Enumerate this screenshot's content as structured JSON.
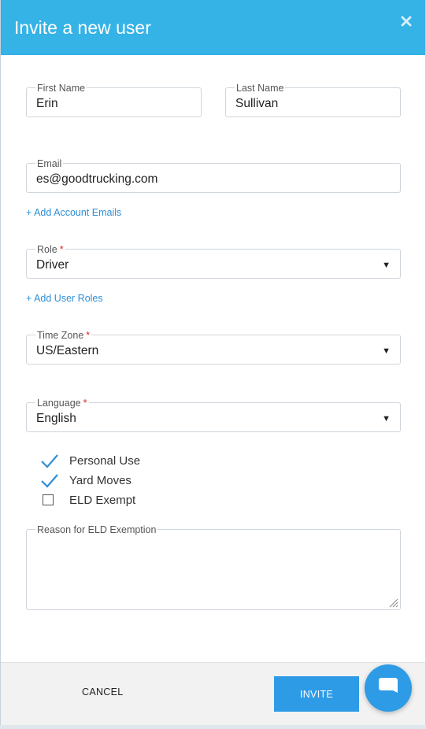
{
  "modal": {
    "title": "Invite a new user",
    "close_icon": "close-icon"
  },
  "form": {
    "first_name": {
      "label": "First Name",
      "value": "Erin"
    },
    "last_name": {
      "label": "Last Name",
      "value": "Sullivan"
    },
    "email": {
      "label": "Email",
      "value": "es@goodtrucking.com"
    },
    "add_account_emails": "+ Add Account Emails",
    "role": {
      "label": "Role",
      "required_mark": "*",
      "value": "Driver"
    },
    "add_user_roles": "+ Add User Roles",
    "time_zone": {
      "label": "Time Zone",
      "required_mark": "*",
      "value": "US/Eastern"
    },
    "language": {
      "label": "Language",
      "required_mark": "*",
      "value": "English"
    },
    "caret": "▼",
    "checkboxes": [
      {
        "label": "Personal Use",
        "checked": true
      },
      {
        "label": "Yard Moves",
        "checked": true
      },
      {
        "label": "ELD Exempt",
        "checked": false
      }
    ],
    "reason": {
      "label": "Reason for ELD Exemption",
      "value": ""
    }
  },
  "footer": {
    "cancel_label": "CANCEL",
    "invite_label": "INVITE"
  },
  "colors": {
    "header": "#35b2e6",
    "primary_button": "#2e9be6",
    "link": "#2f8fd6",
    "required": "#e0242c",
    "check": "#2f8fd6"
  },
  "chat_icon": "chat-bubble-icon"
}
